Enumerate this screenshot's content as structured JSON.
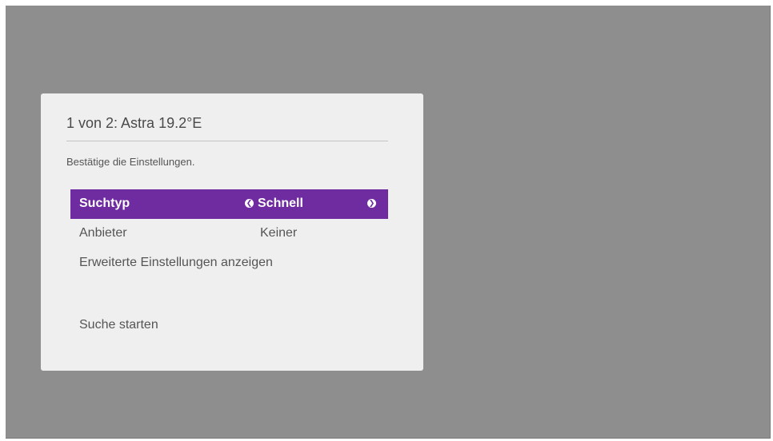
{
  "dialog": {
    "title": "1 von 2: Astra 19.2°E",
    "instruction": "Bestätige die Einstellungen."
  },
  "settings": [
    {
      "label": "Suchtyp",
      "value": "Schnell",
      "selected": true
    },
    {
      "label": "Anbieter",
      "value": "Keiner",
      "selected": false
    }
  ],
  "actions": {
    "advanced_settings": "Erweiterte Einstellungen anzeigen",
    "start_search": "Suche starten"
  },
  "icons": {
    "left_arrow": "chevron-left-icon",
    "right_arrow": "chevron-right-icon"
  },
  "colors": {
    "accent": "#6f2ba0",
    "background": "#8e8e8e",
    "dialog": "#efefef"
  }
}
